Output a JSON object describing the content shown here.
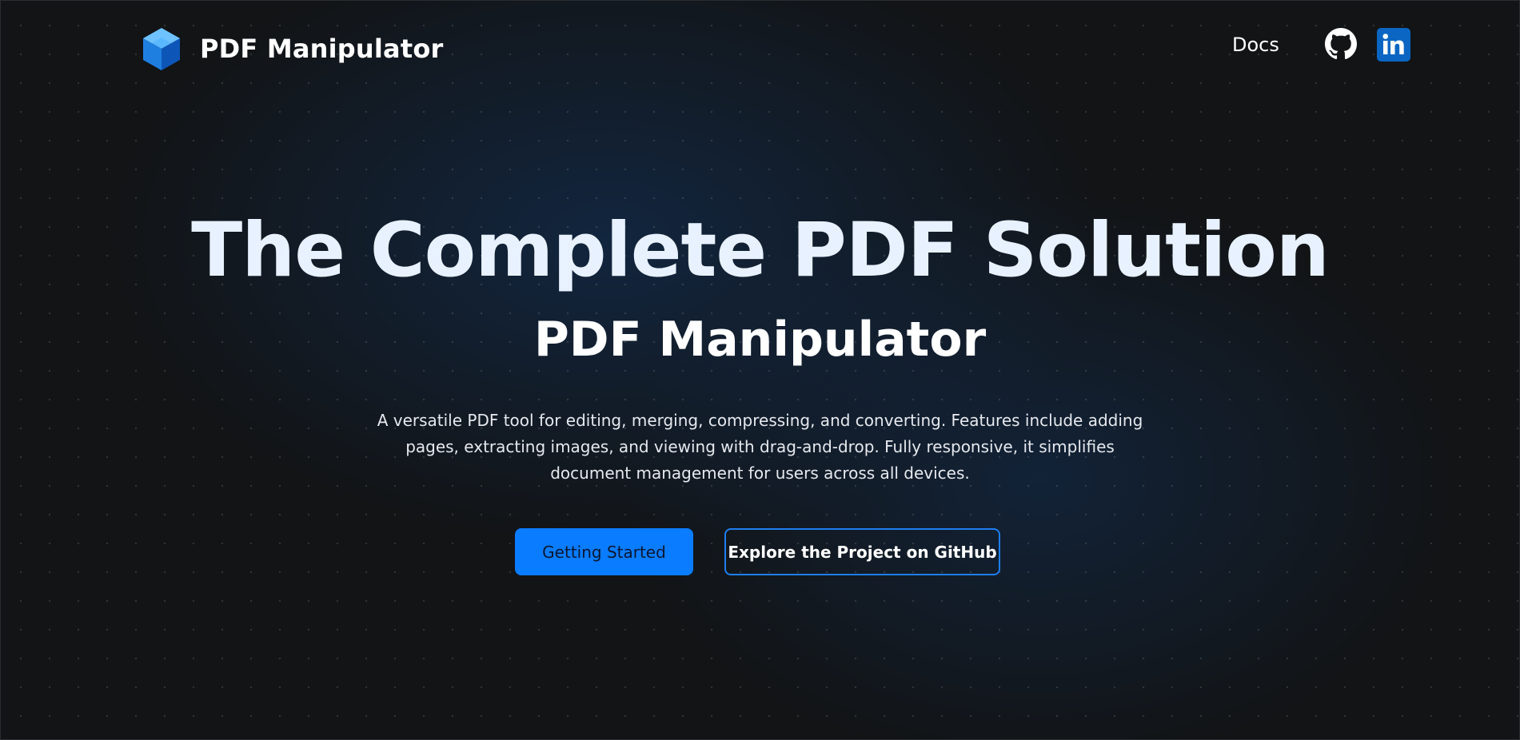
{
  "header": {
    "logo_icon": "cube-logo-icon",
    "brand_name": "PDF Manipulator",
    "nav": {
      "docs_label": "Docs",
      "github_icon": "github-icon",
      "linkedin_icon": "linkedin-icon"
    }
  },
  "hero": {
    "title": "The Complete PDF Solution",
    "subtitle": "PDF Manipulator",
    "description": "A versatile PDF tool for editing, merging, compressing, and converting. Features include adding pages, extracting images, and viewing with drag-and-drop. Fully responsive, it simplifies document management for users across all devices.",
    "primary_button": "Getting Started",
    "secondary_button": "Explore the Project on GitHub"
  },
  "colors": {
    "background": "#121416",
    "accent": "#0a7cff",
    "outline_border": "#1f7ef0",
    "title_tint": "#e8f1ff",
    "linkedin_blue": "#0a66c2"
  }
}
